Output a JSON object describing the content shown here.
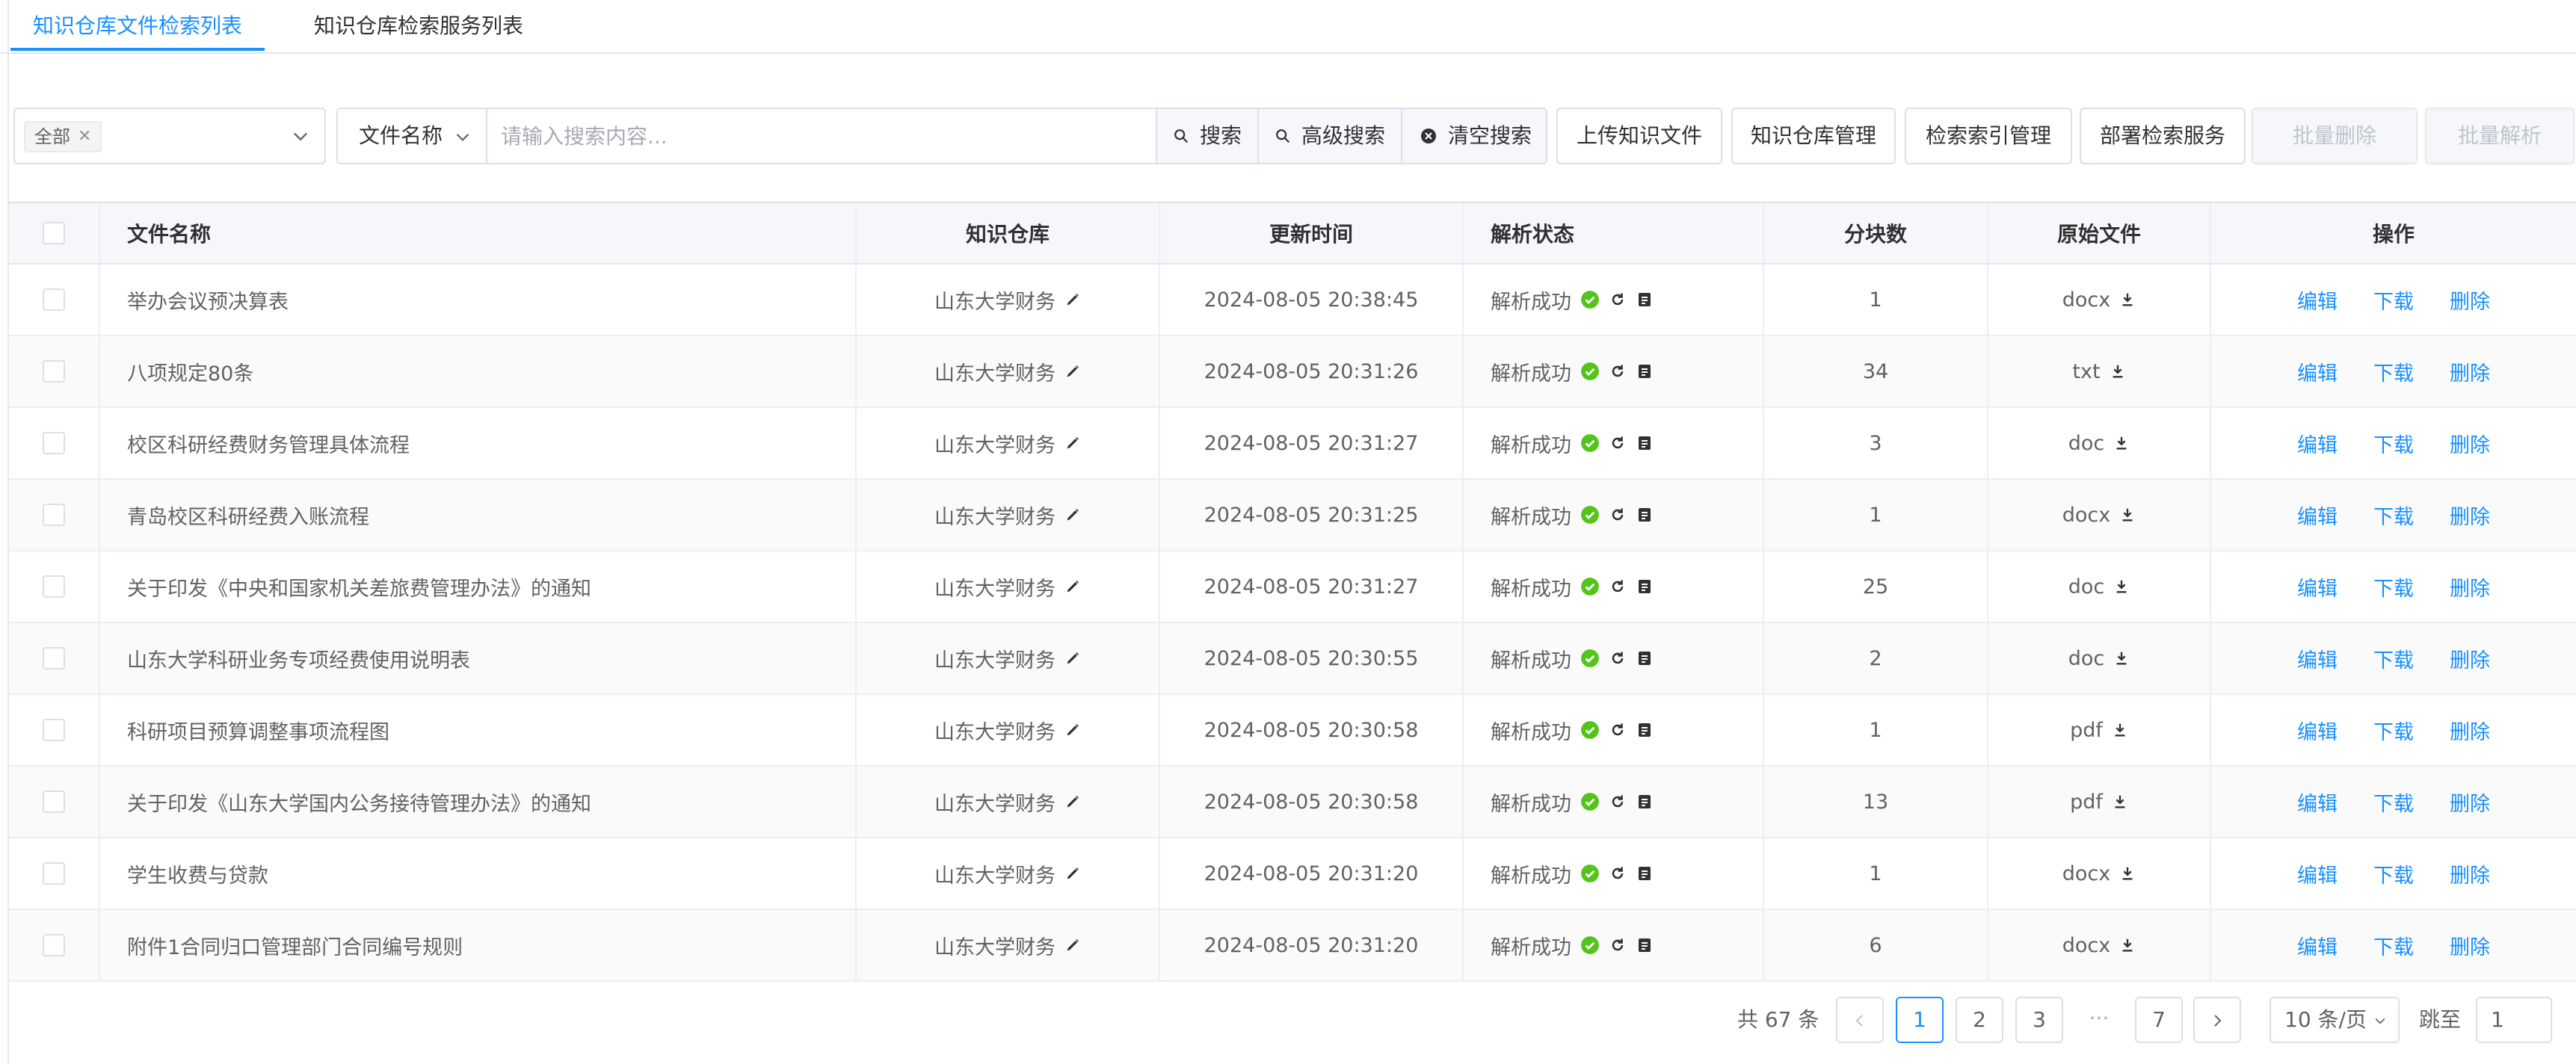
{
  "tabs": [
    {
      "label": "知识仓库文件检索列表",
      "active": true
    },
    {
      "label": "知识仓库检索服务列表",
      "active": false
    }
  ],
  "toolbar": {
    "repo_tag": "全部",
    "field_select": "文件名称",
    "search_placeholder": "请输入搜索内容...",
    "search_label": "搜索",
    "advanced_label": "高级搜索",
    "clear_label": "清空搜索",
    "upload_label": "上传知识文件",
    "repo_manage_label": "知识仓库管理",
    "index_manage_label": "检索索引管理",
    "deploy_label": "部署检索服务",
    "batch_delete_label": "批量删除",
    "batch_parse_label": "批量解析"
  },
  "table": {
    "headers": {
      "name": "文件名称",
      "repo": "知识仓库",
      "time": "更新时间",
      "status": "解析状态",
      "chunks": "分块数",
      "original": "原始文件",
      "ops": "操作"
    },
    "actions": {
      "edit": "编辑",
      "download": "下载",
      "delete": "删除"
    },
    "rows": [
      {
        "name": "举办会议预决算表",
        "repo": "山东大学财务",
        "time": "2024-08-05 20:38:45",
        "status": "解析成功",
        "chunks": "1",
        "ext": "docx"
      },
      {
        "name": "八项规定80条",
        "repo": "山东大学财务",
        "time": "2024-08-05 20:31:26",
        "status": "解析成功",
        "chunks": "34",
        "ext": "txt"
      },
      {
        "name": "校区科研经费财务管理具体流程",
        "repo": "山东大学财务",
        "time": "2024-08-05 20:31:27",
        "status": "解析成功",
        "chunks": "3",
        "ext": "doc"
      },
      {
        "name": "青岛校区科研经费入账流程",
        "repo": "山东大学财务",
        "time": "2024-08-05 20:31:25",
        "status": "解析成功",
        "chunks": "1",
        "ext": "docx"
      },
      {
        "name": "关于印发《中央和国家机关差旅费管理办法》的通知",
        "repo": "山东大学财务",
        "time": "2024-08-05 20:31:27",
        "status": "解析成功",
        "chunks": "25",
        "ext": "doc"
      },
      {
        "name": "山东大学科研业务专项经费使用说明表",
        "repo": "山东大学财务",
        "time": "2024-08-05 20:30:55",
        "status": "解析成功",
        "chunks": "2",
        "ext": "doc"
      },
      {
        "name": "科研项目预算调整事项流程图",
        "repo": "山东大学财务",
        "time": "2024-08-05 20:30:58",
        "status": "解析成功",
        "chunks": "1",
        "ext": "pdf"
      },
      {
        "name": "关于印发《山东大学国内公务接待管理办法》的通知",
        "repo": "山东大学财务",
        "time": "2024-08-05 20:30:58",
        "status": "解析成功",
        "chunks": "13",
        "ext": "pdf"
      },
      {
        "name": "学生收费与贷款",
        "repo": "山东大学财务",
        "time": "2024-08-05 20:31:20",
        "status": "解析成功",
        "chunks": "1",
        "ext": "docx"
      },
      {
        "name": "附件1合同归口管理部门合同编号规则",
        "repo": "山东大学财务",
        "time": "2024-08-05 20:31:20",
        "status": "解析成功",
        "chunks": "6",
        "ext": "docx"
      }
    ]
  },
  "pagination": {
    "total": "共 67 条",
    "pages": [
      "1",
      "2",
      "3",
      "···",
      "7"
    ],
    "current": "1",
    "page_size": "10 条/页",
    "jump_label": "跳至",
    "jump_value": "1"
  },
  "colors": {
    "accent": "#1890ff",
    "success": "#52c41a"
  }
}
